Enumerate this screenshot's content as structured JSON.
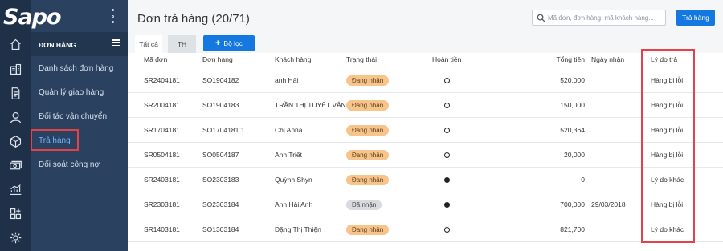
{
  "brand": {
    "logo_text": "Sapo"
  },
  "rail": {
    "icons": [
      "home-icon",
      "building-icon",
      "document-icon",
      "user-icon",
      "box-icon",
      "money-icon",
      "chart-icon",
      "apps-icon",
      "settings-icon"
    ]
  },
  "sidebar": {
    "title": "ĐƠN HÀNG",
    "items": [
      {
        "label": "Danh sách đơn hàng"
      },
      {
        "label": "Quản lý giao hàng"
      },
      {
        "label": "Đối tác vận chuyển"
      },
      {
        "label": "Trả hàng"
      },
      {
        "label": "Đối soát công nợ"
      }
    ]
  },
  "header": {
    "title": "Đơn trả hàng (20/71)",
    "search_placeholder": "Mã đơn, đơn hàng, mã khách hàng...",
    "primary_button": "Trả hàng"
  },
  "tabs": [
    {
      "label": "Tất cả"
    },
    {
      "label": "TH"
    }
  ],
  "filter_button": {
    "label": "Bộ lọc",
    "icon": "plus-icon"
  },
  "table": {
    "columns": [
      "Mã đơn",
      "Đơn hàng",
      "Khách hàng",
      "Trạng thái",
      "Hoàn tiền",
      "Tổng tiền",
      "Ngày nhận",
      "Lý do trả"
    ],
    "rows": [
      {
        "code": "SR2404181",
        "order": "SO1904182",
        "customer": "anh Hải",
        "status": "Đang nhận",
        "refunded": false,
        "total": "520,000",
        "received": "",
        "reason": "Hàng bị lỗi"
      },
      {
        "code": "SR2004181",
        "order": "SO1904183",
        "customer": "TRẦN THỊ TUYẾT VÂN",
        "status": "Đang nhận",
        "refunded": false,
        "total": "150,000",
        "received": "",
        "reason": "Hàng bị lỗi"
      },
      {
        "code": "SR1704181",
        "order": "SO1704181.1",
        "customer": "Chị Anna",
        "status": "Đang nhận",
        "refunded": false,
        "total": "520,364",
        "received": "",
        "reason": "Hàng bị lỗi"
      },
      {
        "code": "SR0504181",
        "order": "SO0504187",
        "customer": "Anh Triết",
        "status": "Đang nhận",
        "refunded": false,
        "total": "20,000",
        "received": "",
        "reason": "Hàng bị lỗi"
      },
      {
        "code": "SR2403181",
        "order": "SO2303183",
        "customer": "Quỳnh Shyn",
        "status": "Đang nhận",
        "refunded": true,
        "total": "0",
        "received": "",
        "reason": "Lý do khác"
      },
      {
        "code": "SR2303181",
        "order": "SO2303184",
        "customer": "Anh Hải Anh",
        "status": "Đã nhận",
        "refunded": true,
        "total": "700,000",
        "received": "29/03/2018",
        "reason": "Hàng bị lỗi"
      },
      {
        "code": "SR1403181",
        "order": "SO1303184",
        "customer": "Đặng Thị Thiện",
        "status": "Đang nhận",
        "refunded": false,
        "total": "821,700",
        "received": "",
        "reason": "Lý do khác"
      }
    ]
  },
  "colors": {
    "rail_bg": "#1f3148",
    "sidebar_bg": "#2a4160",
    "accent": "#1478e0",
    "badge_pending": "#f7c48c",
    "badge_done": "#d8dbdf",
    "highlight": "#e4424a"
  }
}
